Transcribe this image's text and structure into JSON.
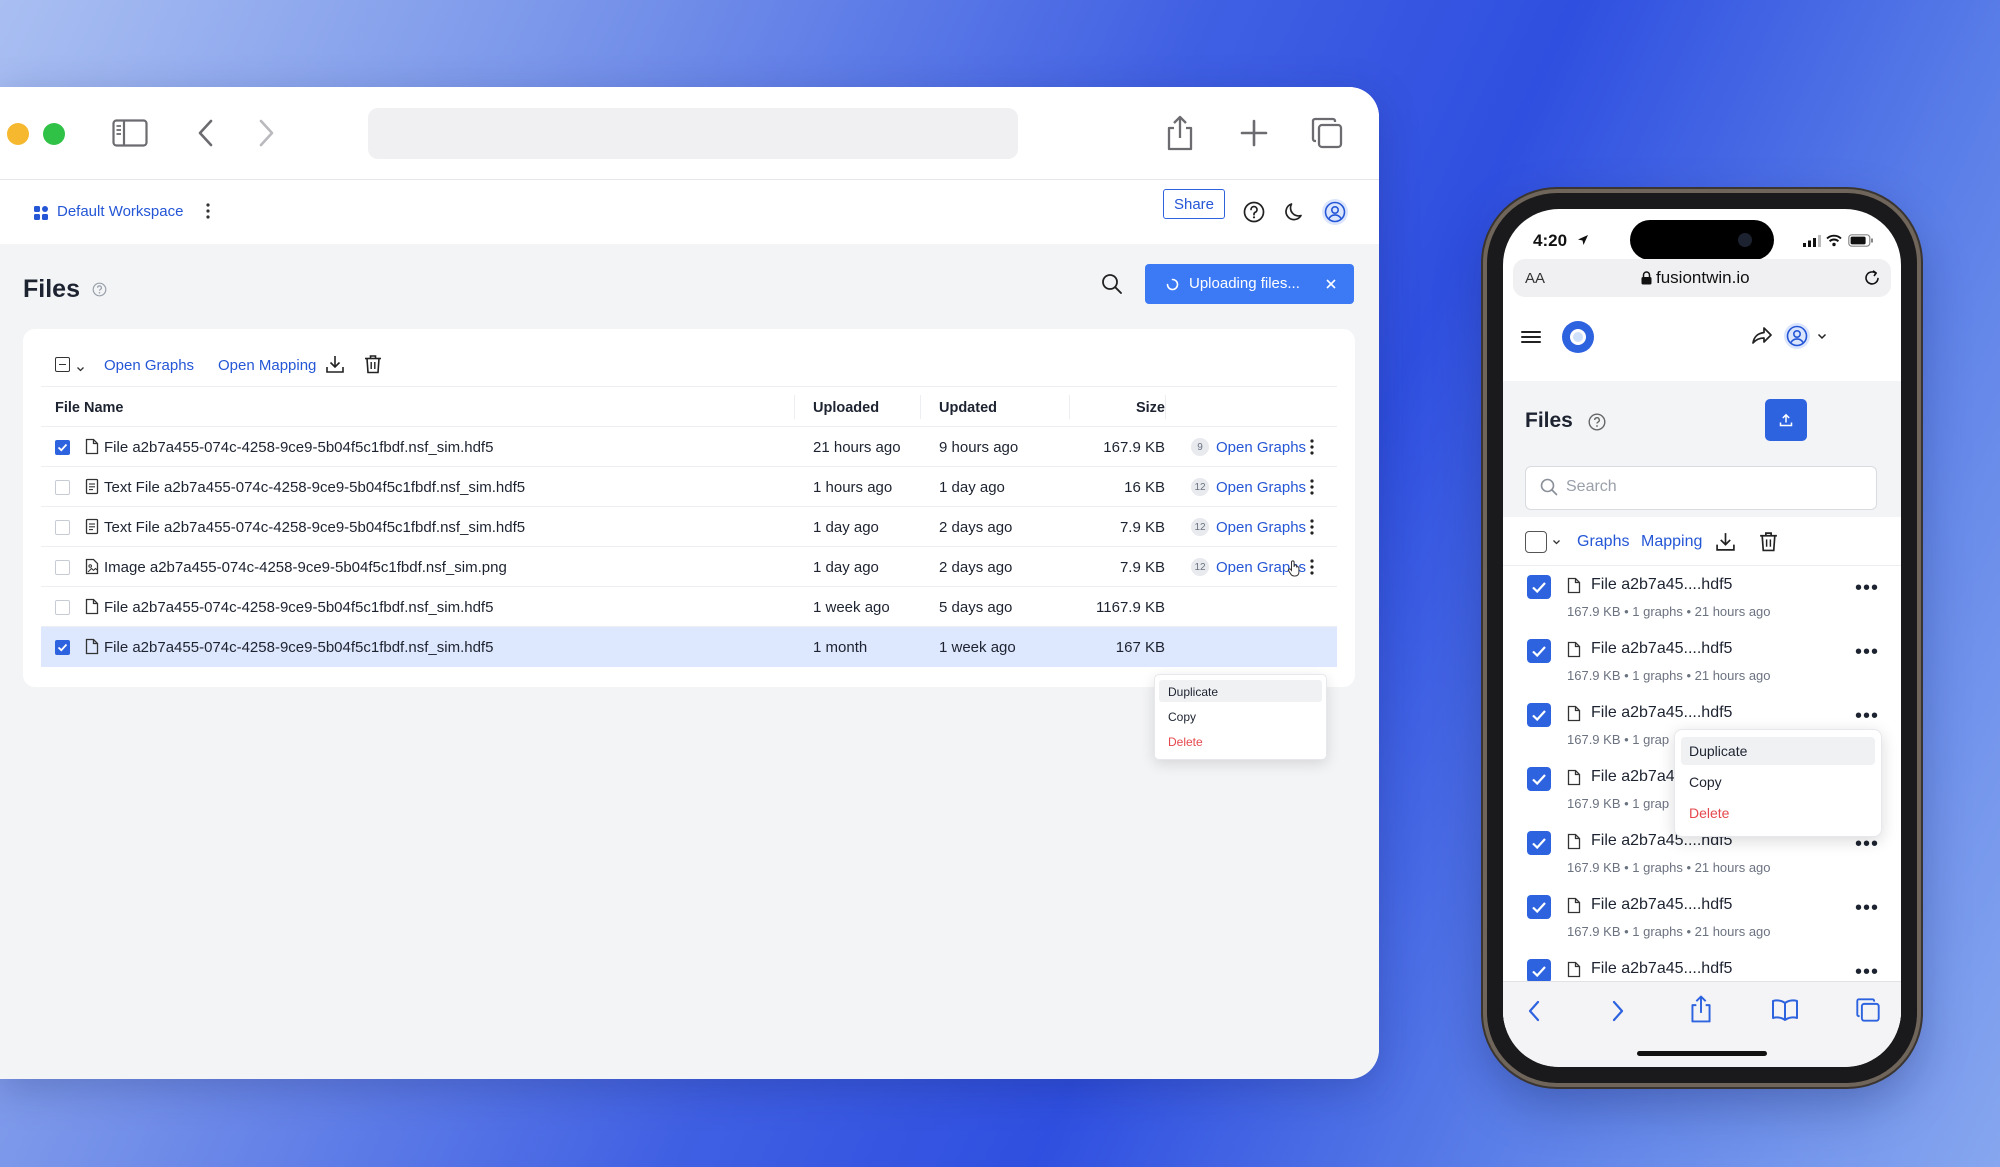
{
  "desktop": {
    "workspace": {
      "name": "Default Workspace"
    },
    "header": {
      "share_label": "Share"
    },
    "page": {
      "title": "Files",
      "upload_status": "Uploading files..."
    },
    "toolbar": {
      "open_graphs": "Open Graphs",
      "open_mapping": "Open Mapping"
    },
    "table": {
      "headers": {
        "name": "File Name",
        "uploaded": "Uploaded",
        "updated": "Updated",
        "size": "Size"
      },
      "rows": [
        {
          "name": "File a2b7a455-074c-4258-9ce9-5b04f5c1fbdf.nsf_sim.hdf5",
          "uploaded": "21 hours ago",
          "updated": "9 hours ago",
          "size": "167.9 KB",
          "graphs": "9",
          "action": "Open Graphs",
          "checked": true
        },
        {
          "name": "Text File a2b7a455-074c-4258-9ce9-5b04f5c1fbdf.nsf_sim.hdf5",
          "uploaded": "1 hours ago",
          "updated": "1 day ago",
          "size": "16 KB",
          "graphs": "12",
          "action": "Open Graphs",
          "checked": false
        },
        {
          "name": "Text File a2b7a455-074c-4258-9ce9-5b04f5c1fbdf.nsf_sim.hdf5",
          "uploaded": "1 day ago",
          "updated": "2 days ago",
          "size": "7.9 KB",
          "graphs": "12",
          "action": "Open Graphs",
          "checked": false
        },
        {
          "name": "Image a2b7a455-074c-4258-9ce9-5b04f5c1fbdf.nsf_sim.png",
          "uploaded": "1 day ago",
          "updated": "2 days ago",
          "size": "7.9 KB",
          "graphs": "12",
          "action": "Open Graphs",
          "checked": false
        },
        {
          "name": "File a2b7a455-074c-4258-9ce9-5b04f5c1fbdf.nsf_sim.hdf5",
          "uploaded": "1 week ago",
          "updated": "5 days ago",
          "size": "1167.9 KB",
          "checked": false
        },
        {
          "name": "File a2b7a455-074c-4258-9ce9-5b04f5c1fbdf.nsf_sim.hdf5",
          "uploaded": "1 month",
          "updated": "1 week ago",
          "size": "167 KB",
          "checked": true
        }
      ]
    },
    "context_menu": {
      "duplicate": "Duplicate",
      "copy": "Copy",
      "delete": "Delete"
    }
  },
  "phone": {
    "status": {
      "time": "4:20"
    },
    "address": {
      "text_size": "AA",
      "domain": "fusiontwin.io"
    },
    "page": {
      "title": "Files"
    },
    "search": {
      "placeholder": "Search"
    },
    "toolbar": {
      "graphs": "Graphs",
      "mapping": "Mapping"
    },
    "items": [
      {
        "name": "File a2b7a45....hdf5",
        "meta": "167.9 KB • 1 graphs • 21 hours ago"
      },
      {
        "name": "File a2b7a45....hdf5",
        "meta": "167.9 KB • 1 graphs • 21 hours ago"
      },
      {
        "name": "File a2b7a45....hdf5",
        "meta": "167.9 KB • 1 grap"
      },
      {
        "name": "File a2b7a4",
        "meta": "167.9 KB • 1 grap"
      },
      {
        "name": "File a2b7a45....hdf5",
        "meta": "167.9 KB • 1 graphs • 21 hours ago"
      },
      {
        "name": "File a2b7a45....hdf5",
        "meta": "167.9 KB • 1 graphs • 21 hours ago"
      },
      {
        "name": "File a2b7a45....hdf5",
        "meta": ""
      }
    ],
    "context_menu": {
      "duplicate": "Duplicate",
      "copy": "Copy",
      "delete": "Delete"
    }
  },
  "colors": {
    "accent": "#2e63e0",
    "link": "#2456d6",
    "danger": "#e5484d",
    "upload": "#3b79f5"
  }
}
